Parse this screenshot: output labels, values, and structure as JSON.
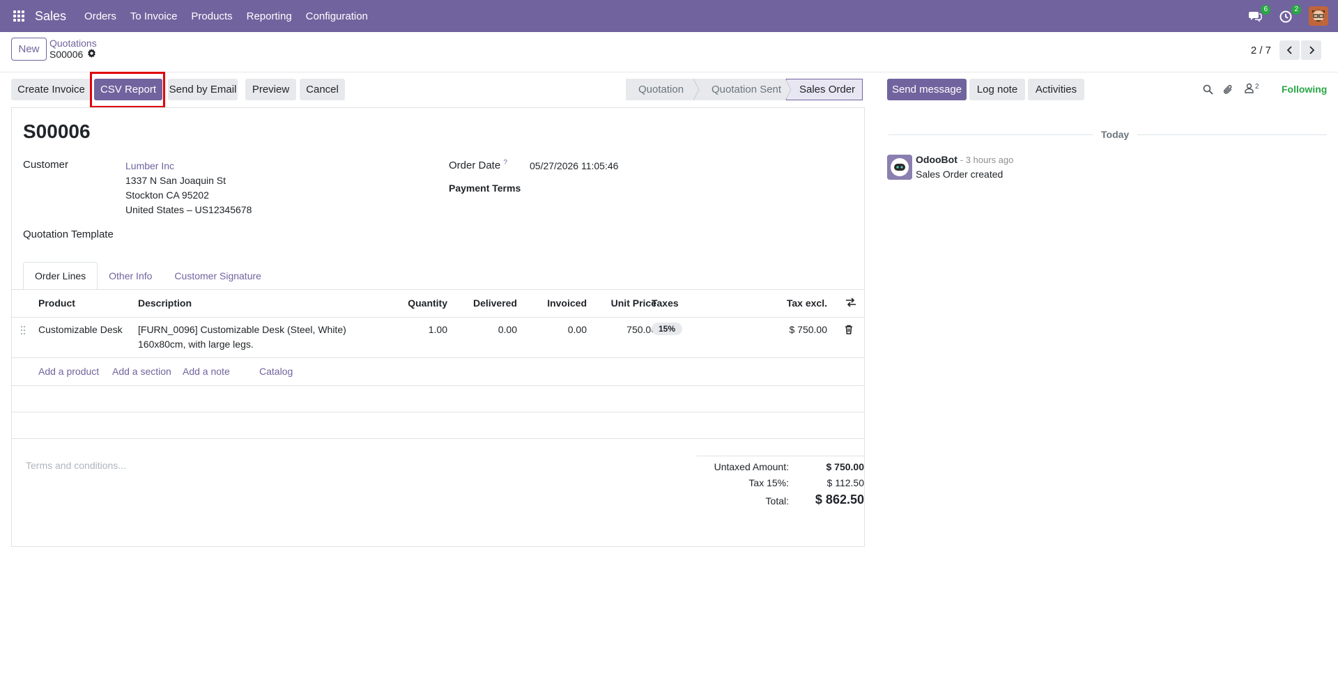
{
  "nav": {
    "app_name": "Sales",
    "menu": [
      "Orders",
      "To Invoice",
      "Products",
      "Reporting",
      "Configuration"
    ],
    "messages_badge": "6",
    "activities_badge": "2",
    "color": "#71639e"
  },
  "control_panel": {
    "new_label": "New",
    "breadcrumb_parent": "Quotations",
    "breadcrumb_current": "S00006",
    "pager_value": "2 / 7"
  },
  "actions": {
    "create_invoice": "Create Invoice",
    "csv_report": "CSV Report",
    "send_by_email": "Send by Email",
    "preview": "Preview",
    "cancel": "Cancel"
  },
  "status": {
    "steps": [
      "Quotation",
      "Quotation Sent",
      "Sales Order"
    ],
    "active": "Sales Order"
  },
  "form": {
    "title": "S00006",
    "customer_label": "Customer",
    "customer_name": "Lumber Inc",
    "address_line1": "1337 N San Joaquin St",
    "address_line2": "Stockton CA 95202",
    "address_line3": "United States – US12345678",
    "template_label": "Quotation Template",
    "order_date_label": "Order Date",
    "order_date_help": "?",
    "order_date_value": "05/27/2026 11:05:46",
    "payment_terms_label": "Payment Terms"
  },
  "tabs": [
    "Order Lines",
    "Other Info",
    "Customer Signature"
  ],
  "order_lines": {
    "headers": {
      "product": "Product",
      "description": "Description",
      "quantity": "Quantity",
      "delivered": "Delivered",
      "invoiced": "Invoiced",
      "unit_price": "Unit Price",
      "taxes": "Taxes",
      "tax_excl": "Tax excl."
    },
    "rows": [
      {
        "product": "Customizable Desk",
        "description_line1": "[FURN_0096] Customizable Desk (Steel, White)",
        "description_line2": "160x80cm, with large legs.",
        "quantity": "1.00",
        "delivered": "0.00",
        "invoiced": "0.00",
        "unit_price": "750.00",
        "tax": "15%",
        "subtotal": "$ 750.00"
      }
    ],
    "add_product": "Add a product",
    "add_section": "Add a section",
    "add_note": "Add a note",
    "catalog": "Catalog"
  },
  "totals": {
    "terms_placeholder": "Terms and conditions...",
    "untaxed_label": "Untaxed Amount:",
    "untaxed_value": "$ 750.00",
    "tax_label": "Tax 15%:",
    "tax_value": "$ 112.50",
    "total_label": "Total:",
    "total_value": "$ 862.50"
  },
  "chatter": {
    "send_message": "Send message",
    "log_note": "Log note",
    "activities": "Activities",
    "followers_count": "2",
    "following": "Following",
    "day_separator": "Today",
    "messages": [
      {
        "author": "OdooBot",
        "date": "- 3 hours ago",
        "body": "Sales Order created"
      }
    ]
  }
}
